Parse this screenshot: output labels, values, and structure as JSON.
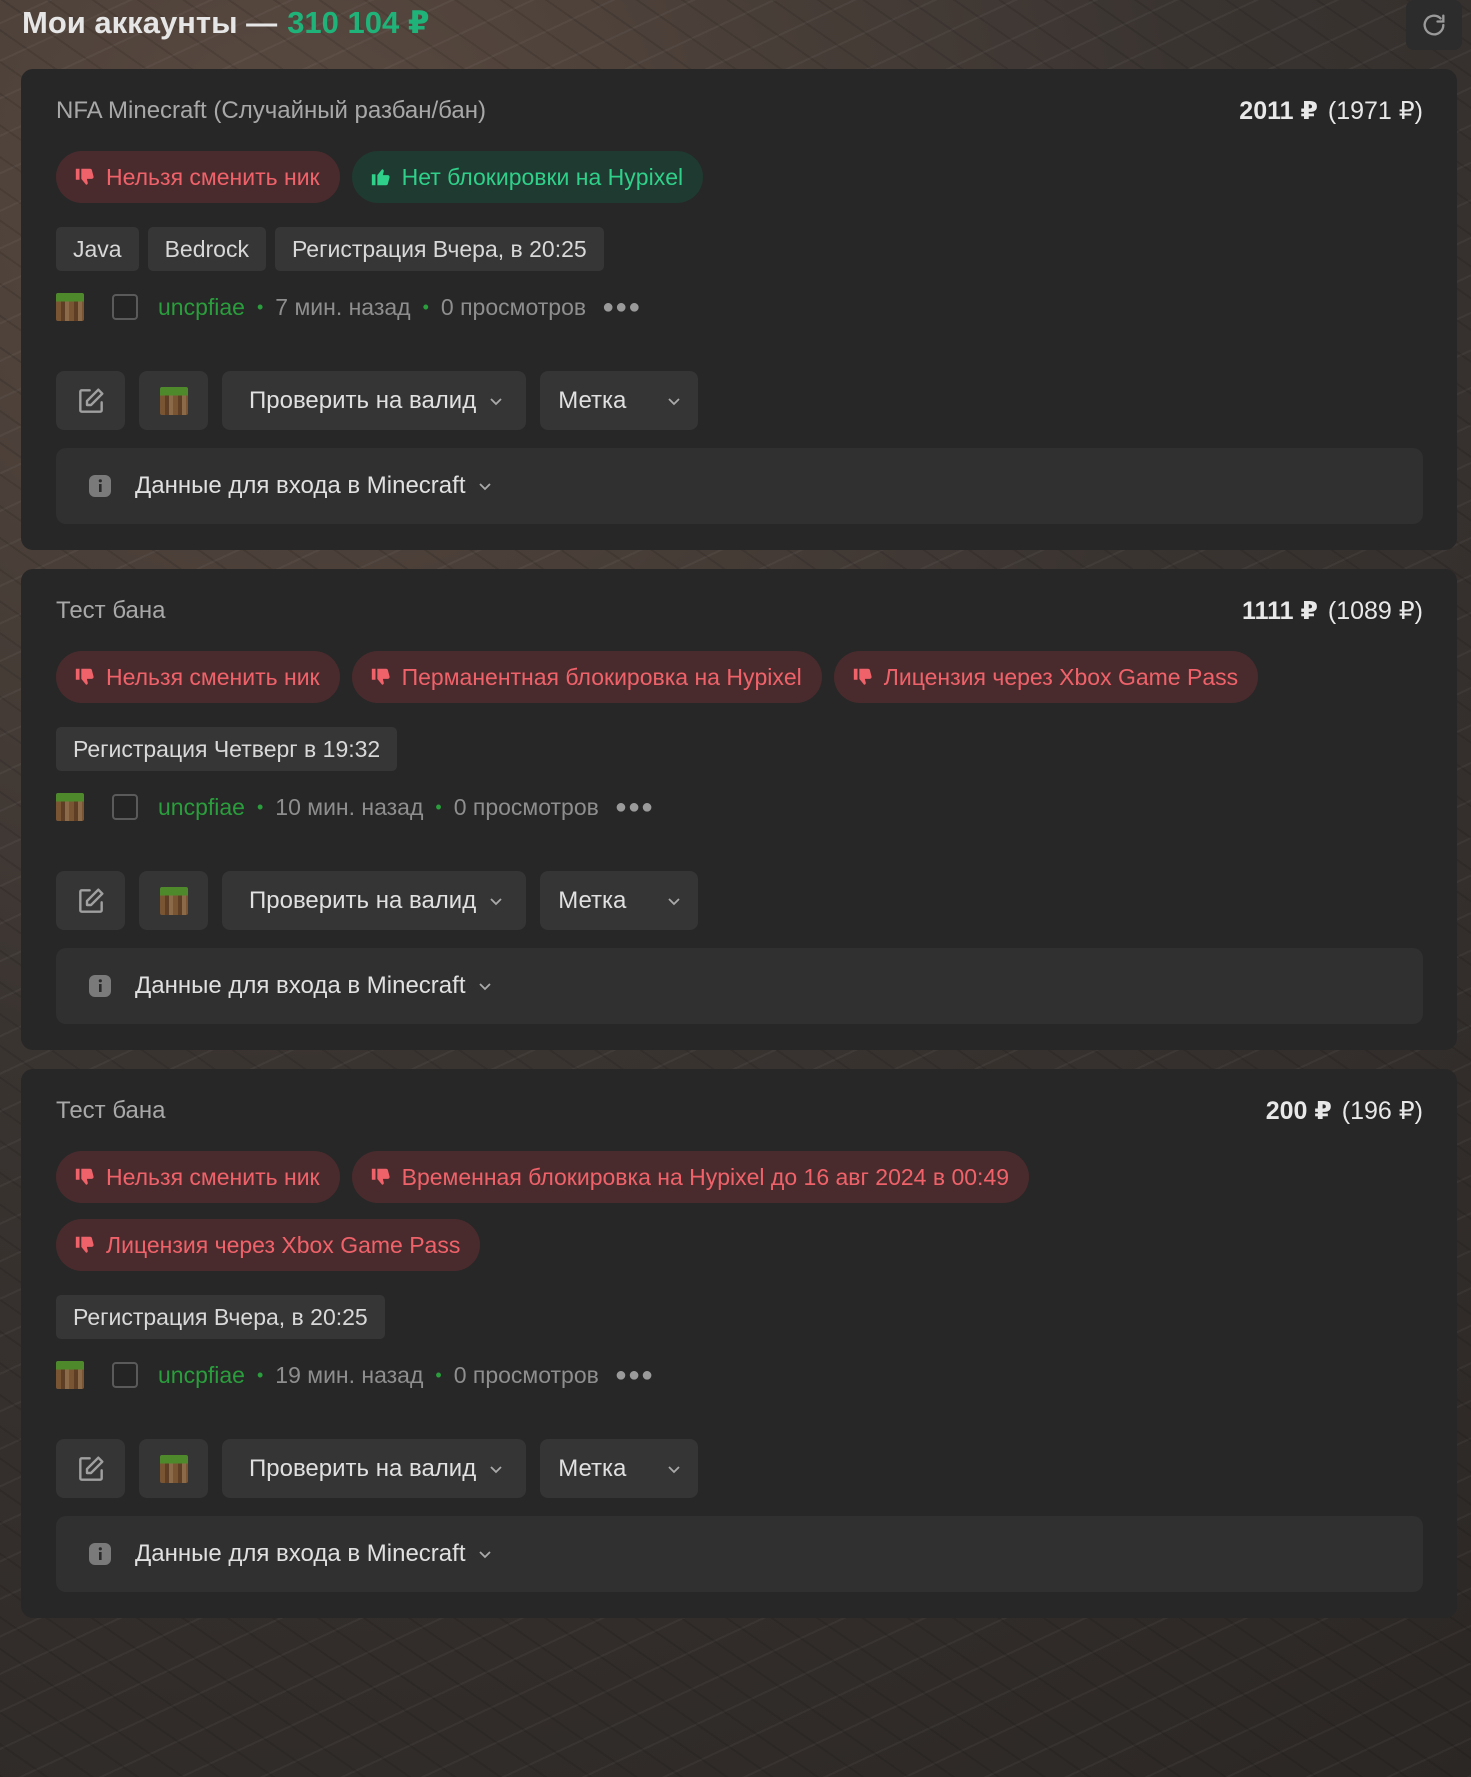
{
  "header": {
    "title": "Мои аккаунты —",
    "total": "310 104 ₽"
  },
  "accounts": [
    {
      "title": "NFA Minecraft (Случайный разбан/бан)",
      "price": "2011 ₽",
      "price_original": "(1971 ₽)",
      "badges": [
        {
          "text": "Нельзя сменить ник",
          "kind": "bad"
        },
        {
          "text": "Нет блокировки на Hypixel",
          "kind": "good"
        }
      ],
      "tags": [
        "Java",
        "Bedrock",
        "Регистрация Вчера, в 20:25"
      ],
      "username": "uncpfiae",
      "time": "7 мин. назад",
      "views": "0 просмотров",
      "check_label": "Проверить на валид",
      "mark_label": "Метка",
      "login_label": "Данные для входа в Minecraft"
    },
    {
      "title": "Тест бана",
      "price": "1111 ₽",
      "price_original": "(1089 ₽)",
      "badges": [
        {
          "text": "Нельзя сменить ник",
          "kind": "bad"
        },
        {
          "text": "Перманентная блокировка на Hypixel",
          "kind": "bad"
        },
        {
          "text": "Лицензия через Xbox Game Pass",
          "kind": "bad"
        }
      ],
      "tags": [
        "Регистрация Четверг в 19:32"
      ],
      "username": "uncpfiae",
      "time": "10 мин. назад",
      "views": "0 просмотров",
      "check_label": "Проверить на валид",
      "mark_label": "Метка",
      "login_label": "Данные для входа в Minecraft"
    },
    {
      "title": "Тест бана",
      "price": "200 ₽",
      "price_original": "(196 ₽)",
      "badges": [
        {
          "text": "Нельзя сменить ник",
          "kind": "bad"
        },
        {
          "text": "Временная блокировка на Hypixel до 16 авг 2024 в 00:49",
          "kind": "bad"
        },
        {
          "text": "Лицензия через Xbox Game Pass",
          "kind": "bad"
        }
      ],
      "tags": [
        "Регистрация Вчера, в 20:25"
      ],
      "username": "uncpfiae",
      "time": "19 мин. назад",
      "views": "0 просмотров",
      "check_label": "Проверить на валид",
      "mark_label": "Метка",
      "login_label": "Данные для входа в Minecraft"
    }
  ],
  "colors": {
    "accent_green": "#1fb37a",
    "bad_red": "#f0626a",
    "good_green": "#2fd08a",
    "username_green": "#2a9d3c"
  },
  "icons": {
    "bad": "thumbs-down-icon",
    "good": "thumbs-up-icon",
    "refresh": "refresh-icon",
    "edit": "edit-icon",
    "info": "info-icon"
  }
}
